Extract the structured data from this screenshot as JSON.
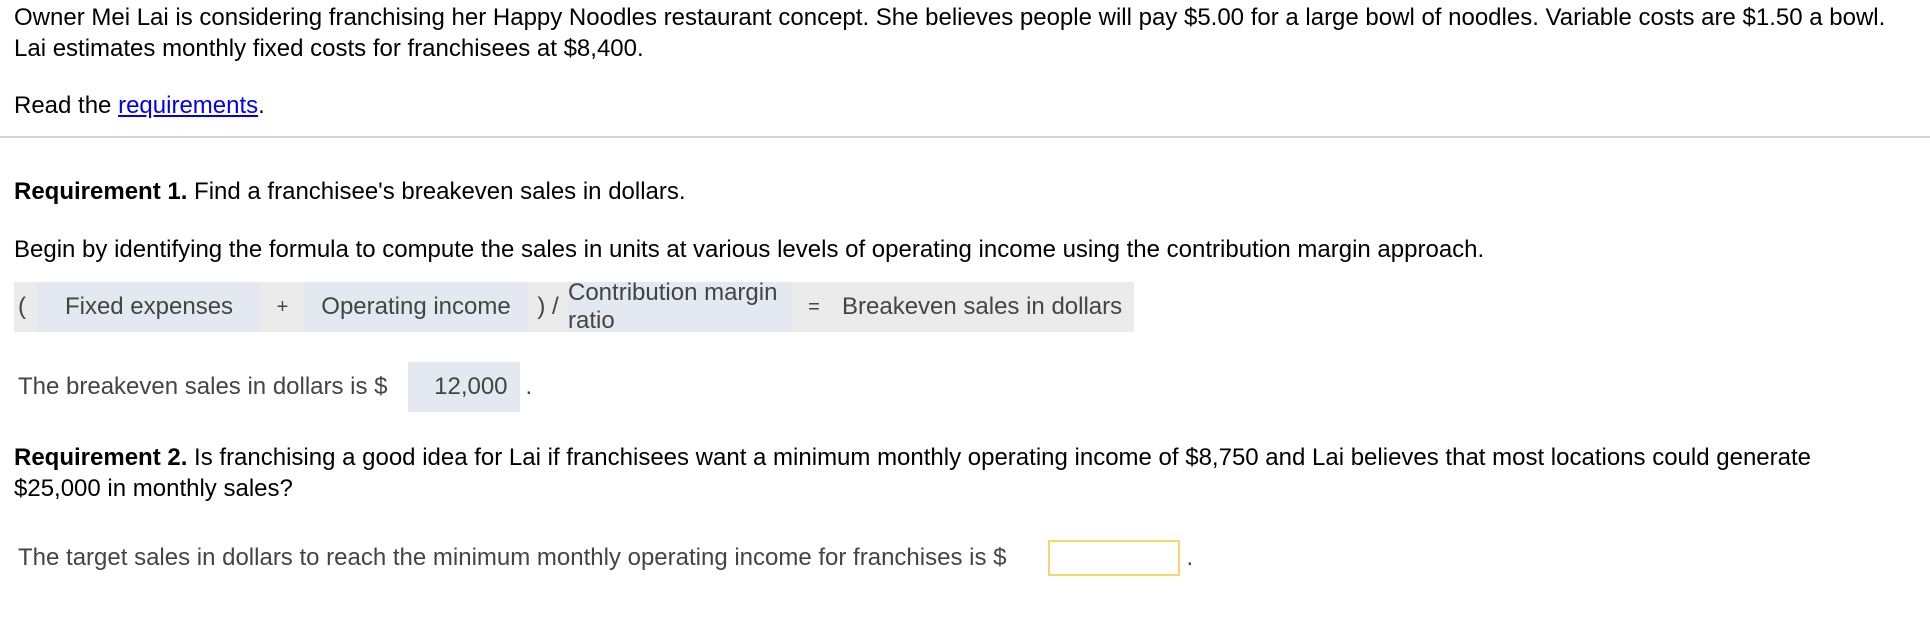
{
  "problem": {
    "intro": "Owner Mei Lai is considering franchising her Happy Noodles restaurant concept. She believes people will pay $5.00 for a large bowl of noodles. Variable costs are $1.50 a bowl. Lai estimates monthly fixed costs for franchisees at $8,400.",
    "read_prefix": "Read the ",
    "read_link": "requirements",
    "read_suffix": "."
  },
  "requirement1": {
    "label": "Requirement 1.",
    "text": " Find a franchisee's breakeven sales in dollars.",
    "instruction": "Begin by identifying the formula to compute the sales in units at various levels of operating income using the contribution margin approach.",
    "formula": {
      "open_paren": "(",
      "term1": "Fixed expenses",
      "plus": "+",
      "term2": "Operating income",
      "close_div": ") /",
      "term3": "Contribution margin ratio",
      "equals": "=",
      "result": "Breakeven sales in dollars"
    },
    "answer_prefix": "The breakeven sales in dollars is $",
    "answer_value": "12,000",
    "answer_suffix": "."
  },
  "requirement2": {
    "label": "Requirement 2.",
    "text": " Is franchising a good idea for Lai if franchisees want a minimum monthly operating income of $8,750 and Lai believes that most locations could generate $25,000 in monthly sales?",
    "answer_prefix": "The target sales in dollars to reach the minimum monthly operating income for franchises is $",
    "answer_value": "",
    "answer_suffix": "."
  },
  "colors": {
    "link": "#0000ee",
    "filled_slot": "#e3e8f1",
    "formula_bg": "#ebebeb",
    "active_input_border": "#f5d76e",
    "separator": "#cfd5df"
  }
}
